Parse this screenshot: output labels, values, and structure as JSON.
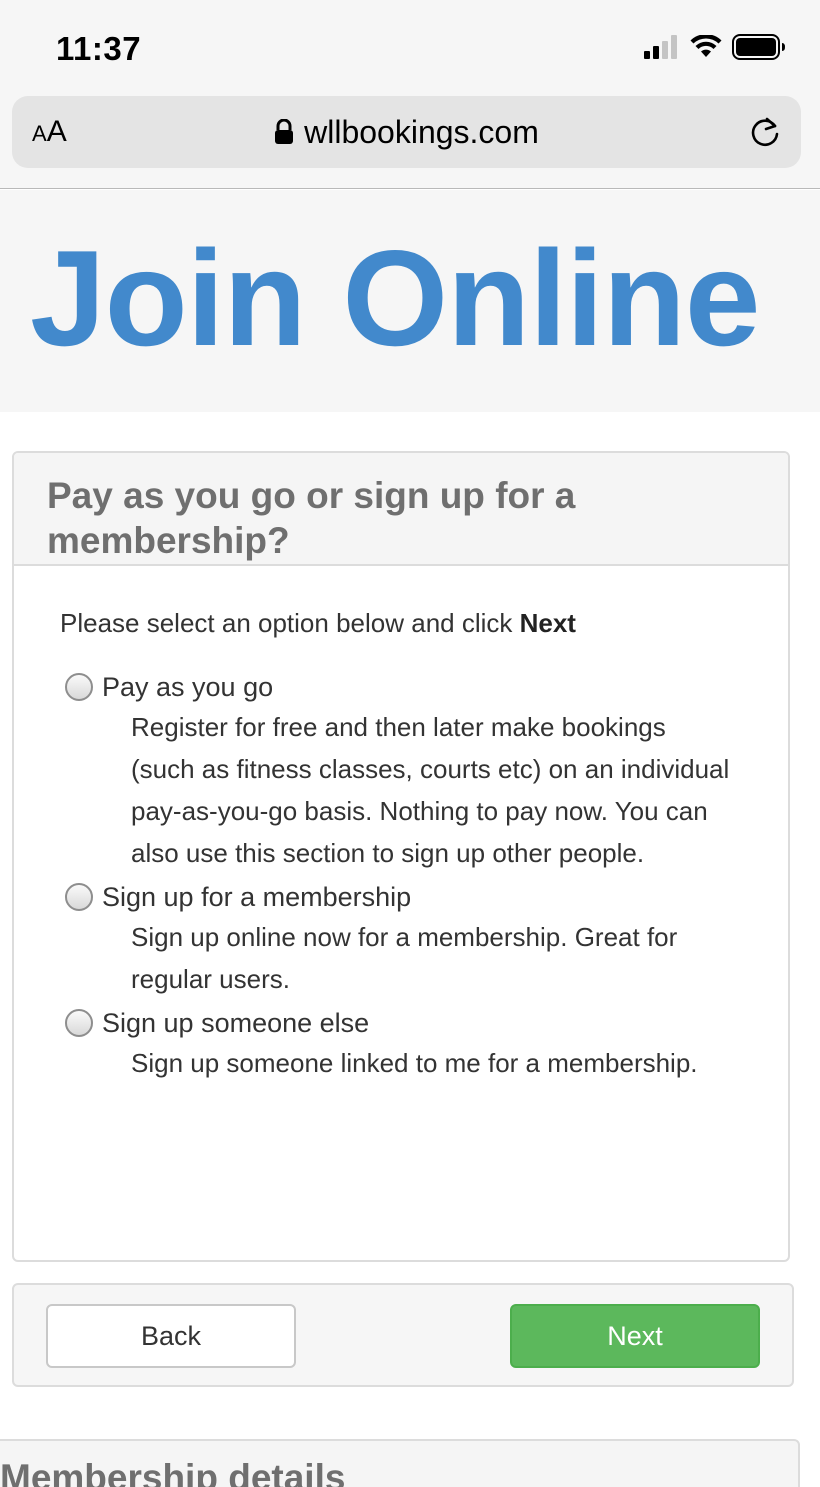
{
  "status_bar": {
    "time": "11:37"
  },
  "browser": {
    "text_size_label_small": "A",
    "text_size_label_large": "A",
    "url": "wllbookings.com"
  },
  "hero": {
    "title": "Join Online",
    "color": "#4289cc"
  },
  "panel": {
    "title": "Pay as you go or sign up for a membership?",
    "intro_text": "Please select an option below and click ",
    "intro_bold": "Next",
    "options": [
      {
        "label": "Pay as you go",
        "description": "Register for free and then later make bookings (such as fitness classes, courts etc) on an individual pay-as-you-go basis. Nothing to pay now. You can also use this section to sign up other people."
      },
      {
        "label": "Sign up for a membership",
        "description": "Sign up online now for a membership. Great for regular users."
      },
      {
        "label": "Sign up someone else",
        "description": "Sign up someone linked to me for a membership."
      }
    ]
  },
  "actions": {
    "back_label": "Back",
    "next_label": "Next",
    "next_color": "#5cb85c"
  },
  "next_section": {
    "title": "Membership details"
  }
}
